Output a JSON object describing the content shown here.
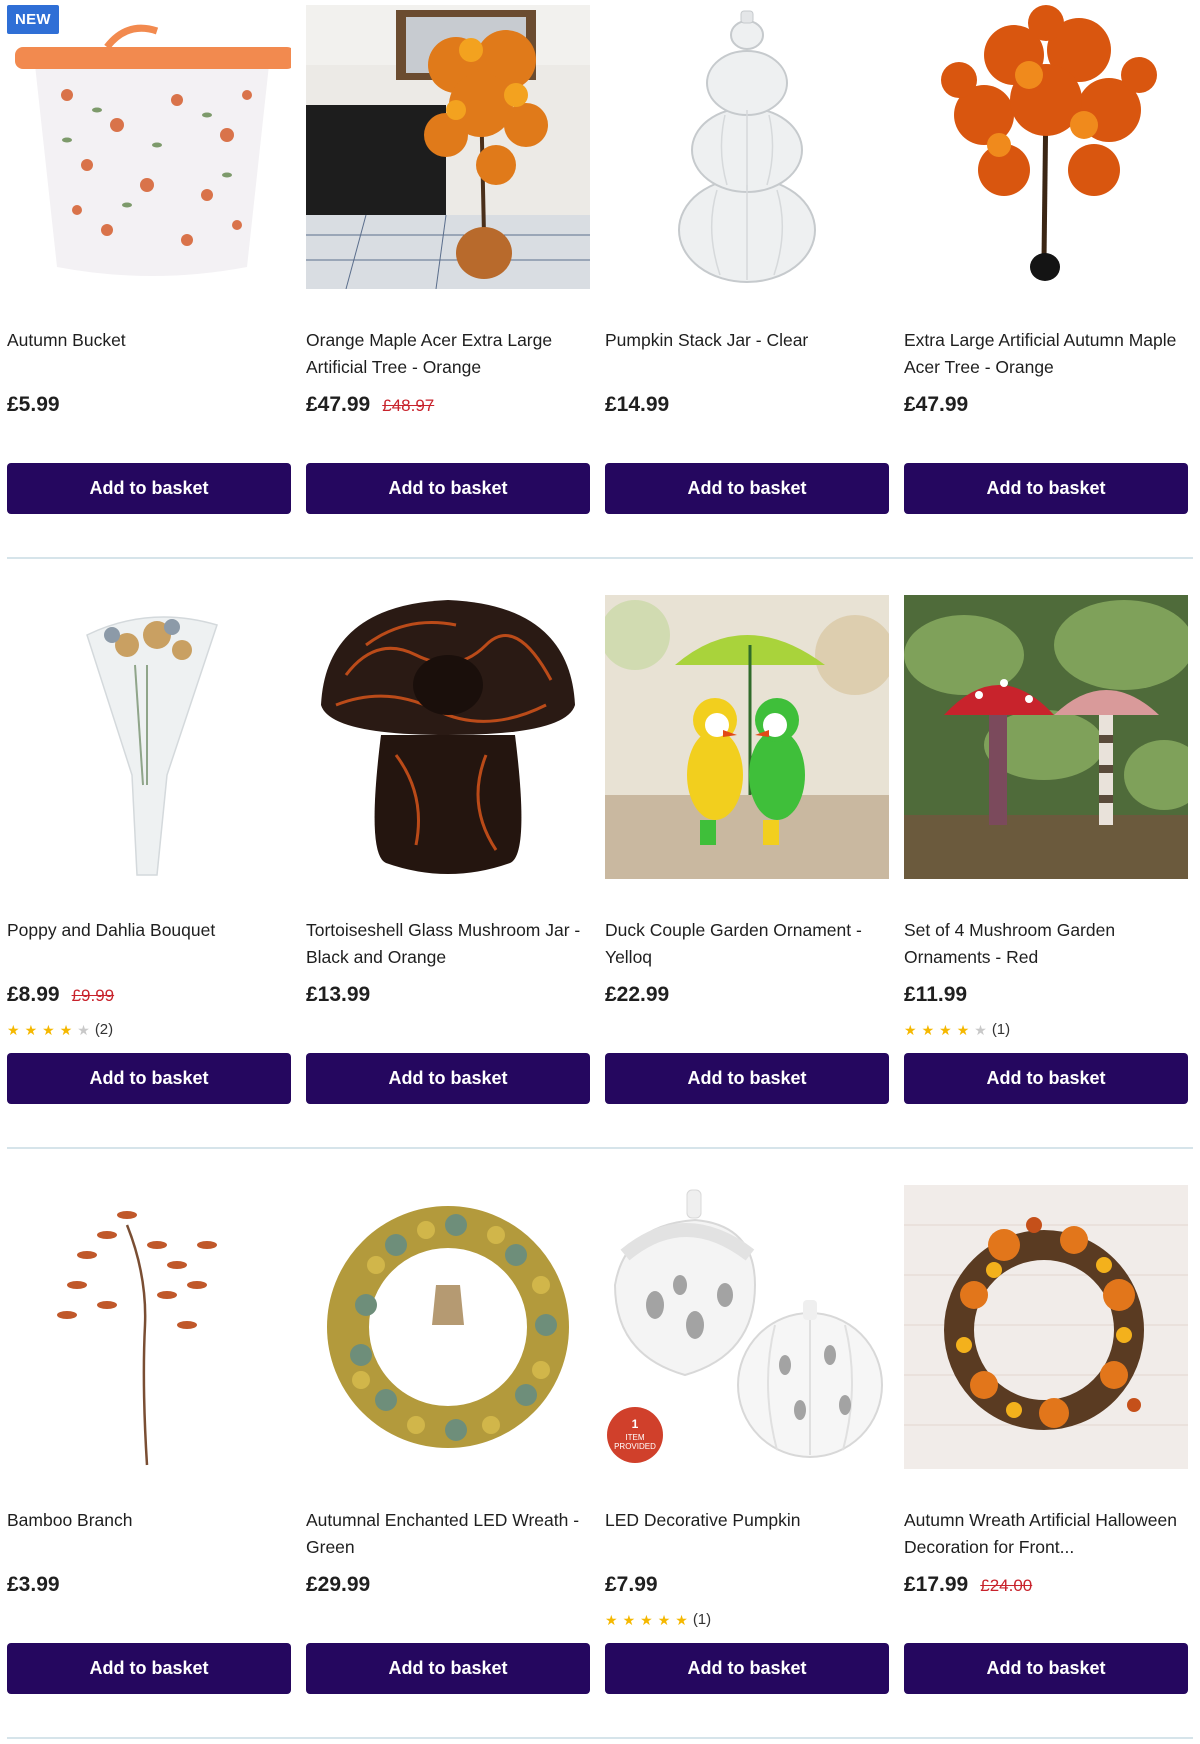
{
  "rows": [
    {
      "products": [
        {
          "name": "Autumn Bucket",
          "price": "£5.99",
          "was_price": "",
          "rating": null,
          "badge": "NEW",
          "button": "Add to basket",
          "image": "autumn-bucket-image"
        },
        {
          "name": "Orange Maple Acer Extra Large Artificial Tree - Orange",
          "price": "£47.99",
          "was_price": "£48.97",
          "rating": null,
          "badge": "",
          "button": "Add to basket",
          "image": "maple-tree-image"
        },
        {
          "name": "Pumpkin Stack Jar - Clear",
          "price": "£14.99",
          "was_price": "",
          "rating": null,
          "badge": "",
          "button": "Add to basket",
          "image": "pumpkin-jar-image"
        },
        {
          "name": "Extra Large Artificial Autumn Maple Acer Tree - Orange",
          "price": "£47.99",
          "was_price": "",
          "rating": null,
          "badge": "",
          "button": "Add to basket",
          "image": "large-maple-tree-image"
        }
      ]
    },
    {
      "products": [
        {
          "name": "Poppy and Dahlia Bouquet",
          "price": "£8.99",
          "was_price": "£9.99",
          "rating": {
            "stars": 4,
            "count": "(2)"
          },
          "badge": "",
          "button": "Add to basket",
          "image": "bouquet-image"
        },
        {
          "name": "Tortoiseshell Glass Mushroom Jar - Black and Orange",
          "price": "£13.99",
          "was_price": "",
          "rating": null,
          "badge": "",
          "button": "Add to basket",
          "image": "mushroom-jar-image"
        },
        {
          "name": "Duck Couple Garden Ornament - Yelloq",
          "price": "£22.99",
          "was_price": "",
          "rating": null,
          "badge": "",
          "button": "Add to basket",
          "image": "duck-ornament-image"
        },
        {
          "name": "Set of 4 Mushroom Garden Ornaments - Red",
          "price": "£11.99",
          "was_price": "",
          "rating": {
            "stars": 4,
            "count": "(1)"
          },
          "badge": "",
          "button": "Add to basket",
          "image": "mushroom-ornaments-image"
        }
      ]
    },
    {
      "products": [
        {
          "name": "Bamboo Branch",
          "price": "£3.99",
          "was_price": "",
          "rating": null,
          "badge": "",
          "button": "Add to basket",
          "image": "bamboo-branch-image"
        },
        {
          "name": "Autumnal Enchanted LED Wreath - Green",
          "price": "£29.99",
          "was_price": "",
          "rating": null,
          "badge": "",
          "button": "Add to basket",
          "image": "led-wreath-image"
        },
        {
          "name": "LED Decorative Pumpkin",
          "price": "£7.99",
          "was_price": "",
          "rating": {
            "stars": 5,
            "count": "(1)"
          },
          "badge": "",
          "button": "Add to basket",
          "image": "led-pumpkin-image",
          "image_sticker": [
            "1",
            "ITEM",
            "PROVIDED"
          ]
        },
        {
          "name": "Autumn Wreath Artificial Halloween Decoration for Front...",
          "price": "£17.99",
          "was_price": "£24.00",
          "rating": null,
          "badge": "",
          "button": "Add to basket",
          "image": "autumn-wreath-image"
        }
      ]
    }
  ],
  "colors": {
    "button_bg": "#25075f",
    "sale_price": "#c8232c",
    "badge_bg": "#2f6fd6",
    "star": "#f5b800"
  }
}
